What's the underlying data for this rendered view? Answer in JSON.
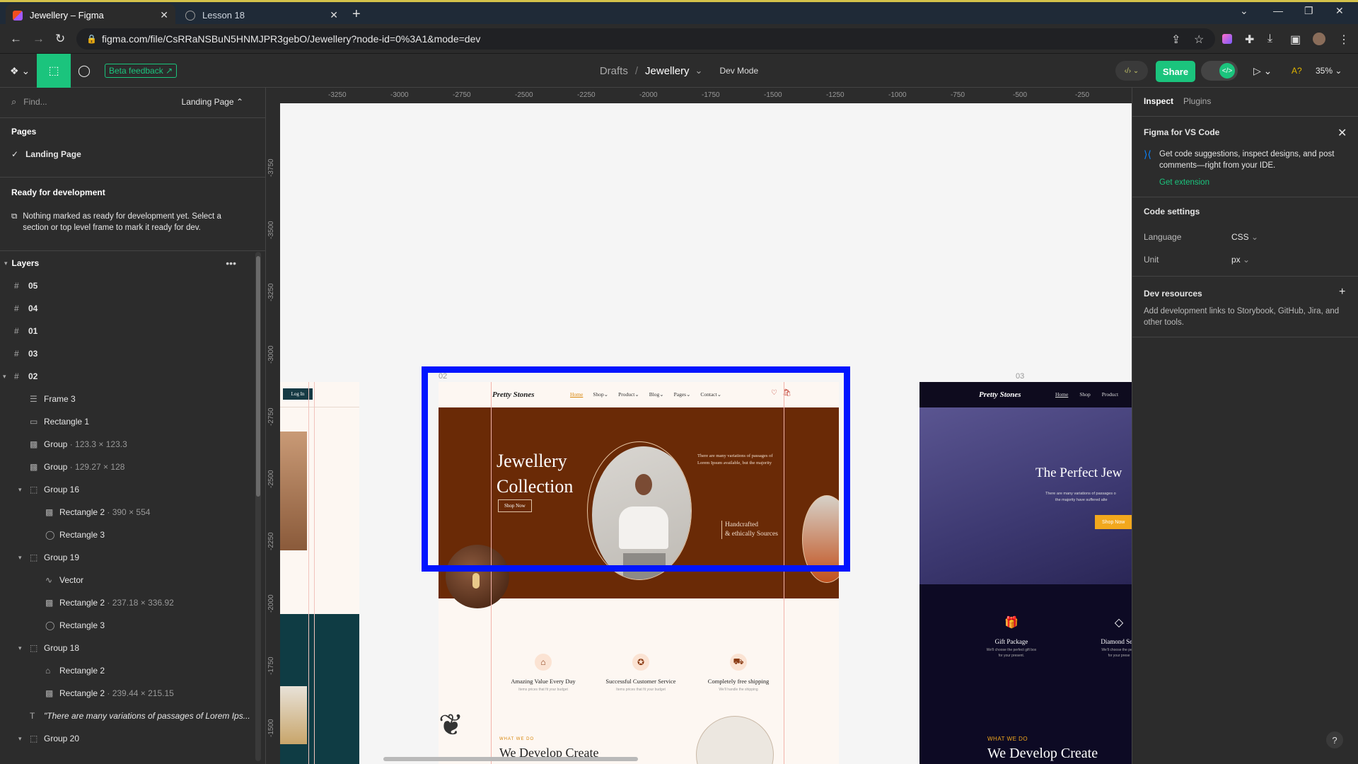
{
  "browser": {
    "tabs": [
      {
        "title": "Jewellery – Figma",
        "active": true
      },
      {
        "title": "Lesson 18",
        "active": false
      }
    ],
    "url": "figma.com/file/CsRRaNSBuN5HNMJPR3gebO/Jewellery?node-id=0%3A1&mode=dev"
  },
  "toolbar": {
    "beta_feedback": "Beta feedback",
    "breadcrumb_drafts": "Drafts",
    "breadcrumb_sep": "/",
    "file_name": "Jewellery",
    "mode": "Dev Mode",
    "share": "Share",
    "zoom": "35%",
    "code_toggle": "</>"
  },
  "left_panel": {
    "find_placeholder": "Find...",
    "page_selector": "Landing Page",
    "pages_title": "Pages",
    "pages": [
      "Landing Page"
    ],
    "ready_title": "Ready for development",
    "ready_text": "Nothing marked as ready for development yet. Select a section or top level frame to mark it ready for dev.",
    "layers_title": "Layers",
    "layers": [
      {
        "name": "05",
        "type": "frame",
        "depth": 0
      },
      {
        "name": "04",
        "type": "frame",
        "depth": 0
      },
      {
        "name": "01",
        "type": "frame",
        "depth": 0
      },
      {
        "name": "03",
        "type": "frame",
        "depth": 0
      },
      {
        "name": "02",
        "type": "frame",
        "depth": 0,
        "expanded": true
      },
      {
        "name": "Frame 3",
        "type": "frame-auto",
        "depth": 1
      },
      {
        "name": "Rectangle 1",
        "type": "rect",
        "depth": 1
      },
      {
        "name": "Group",
        "detail": "123.3 × 123.3",
        "type": "image",
        "depth": 1
      },
      {
        "name": "Group",
        "detail": "129.27 × 128",
        "type": "image",
        "depth": 1
      },
      {
        "name": "Group 16",
        "type": "group",
        "depth": 1,
        "expanded": true
      },
      {
        "name": "Rectangle 2",
        "detail": "390 × 554",
        "type": "image",
        "depth": 2
      },
      {
        "name": "Rectangle 3",
        "type": "ellipse",
        "depth": 2
      },
      {
        "name": "Group 19",
        "type": "group",
        "depth": 1,
        "expanded": true
      },
      {
        "name": "Vector",
        "type": "vector",
        "depth": 2
      },
      {
        "name": "Rectangle 2",
        "detail": "237.18 × 336.92",
        "type": "image",
        "depth": 2
      },
      {
        "name": "Rectangle 3",
        "type": "ellipse",
        "depth": 2
      },
      {
        "name": "Group 18",
        "type": "group",
        "depth": 1,
        "expanded": true
      },
      {
        "name": "Rectangle 2",
        "type": "shape",
        "depth": 2
      },
      {
        "name": "Rectangle 2",
        "detail": "239.44 × 215.15",
        "type": "image",
        "depth": 2
      },
      {
        "name": "\"There are many variations of passages of Lorem Ips...",
        "type": "text",
        "depth": 1
      },
      {
        "name": "Group 20",
        "type": "group",
        "depth": 1,
        "expanded": true
      }
    ]
  },
  "right_panel": {
    "tabs": [
      "Inspect",
      "Plugins"
    ],
    "vscode_title": "Figma for VS Code",
    "vscode_text": "Get code suggestions, inspect designs, and post comments—right from your IDE.",
    "vscode_link": "Get extension",
    "code_settings_title": "Code settings",
    "language_label": "Language",
    "language_value": "CSS",
    "unit_label": "Unit",
    "unit_value": "px",
    "dev_resources_title": "Dev resources",
    "dev_resources_text": "Add development links to Storybook, GitHub, Jira, and other tools."
  },
  "canvas": {
    "ruler_top": [
      "-3250",
      "-3000",
      "-2750",
      "-2500",
      "-2250",
      "-2000",
      "-1750",
      "-1500",
      "-1250",
      "-1000",
      "-750",
      "-500",
      "-250"
    ],
    "ruler_left": [
      "-3750",
      "-3500",
      "-3250",
      "-3000",
      "-2750",
      "-2500",
      "-2250",
      "-2000",
      "-1750",
      "-1500"
    ],
    "frame_labels": {
      "f02": "02",
      "f03": "03"
    },
    "frame01": {
      "login": "Log In"
    },
    "frame02": {
      "logo": "Pretty Stones",
      "nav": [
        "Home",
        "Shop",
        "Product",
        "Blog",
        "Pages",
        "Contact"
      ],
      "hero_title_1": "Jewellery",
      "hero_title_2": "Collection",
      "hero_cta": "Shop Now",
      "hero_text": "There are many variations of passages of Lorem Ipsum available, but the majority",
      "hero_tag_1": "Handcrafted",
      "hero_tag_2": "& ethically Sources",
      "features": [
        {
          "title": "Amazing Value Every Day",
          "sub": "Items prices that fit your budget"
        },
        {
          "title": "Successful Customer Service",
          "sub": "Items prices that fit your budget"
        },
        {
          "title": "Completely free shipping",
          "sub": "We'll handle the shipping"
        }
      ],
      "what_we_do": "WHAT WE DO",
      "develop_title": "We Develop Create"
    },
    "frame03": {
      "logo": "Pretty Stones",
      "nav": [
        "Home",
        "Shop",
        "Product"
      ],
      "hero_title": "The Perfect Jew",
      "hero_text_1": "There are many variations of passages o",
      "hero_text_2": "the majority have suffered alte",
      "cta": "Shop Now",
      "features": [
        {
          "title": "Gift Package",
          "sub1": "We'll choose the perfect gift box",
          "sub2": "for your present."
        },
        {
          "title": "Diamond Sele",
          "sub1": "We'll choose the perfe",
          "sub2": "for your prese"
        }
      ],
      "what_we_do": "WHAT WE DO",
      "develop_title": "We Develop Create"
    }
  },
  "help": "?"
}
